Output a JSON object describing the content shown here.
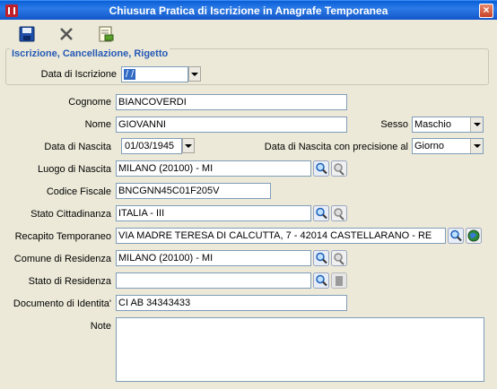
{
  "window": {
    "title": "Chiusura Pratica di Iscrizione in Anagrafe Temporanea"
  },
  "toolbar": {
    "save_icon": "save-icon",
    "cancel_icon": "close-icon",
    "print_icon": "document-edit-icon"
  },
  "group": {
    "legend": "Iscrizione, Cancellazione, Rigetto",
    "data_iscrizione_label": "Data di Iscrizione",
    "data_iscrizione_value": " / /"
  },
  "form": {
    "cognome_label": "Cognome",
    "cognome_value": "BIANCOVERDI",
    "nome_label": "Nome",
    "nome_value": "GIOVANNI",
    "sesso_label": "Sesso",
    "sesso_value": "Maschio",
    "data_nascita_label": "Data di Nascita",
    "data_nascita_value": "01/03/1945",
    "precisione_label": "Data di Nascita con precisione al",
    "precisione_value": "Giorno",
    "luogo_nascita_label": "Luogo di Nascita",
    "luogo_nascita_value": "MILANO (20100) - MI",
    "codice_fiscale_label": "Codice Fiscale",
    "codice_fiscale_value": "BNCGNN45C01F205V",
    "stato_cittadinanza_label": "Stato Cittadinanza",
    "stato_cittadinanza_value": "ITALIA - III",
    "recapito_label": "Recapito Temporaneo",
    "recapito_value": "VIA MADRE TERESA DI CALCUTTA, 7 - 42014 CASTELLARANO - RE",
    "comune_residenza_label": "Comune di Residenza",
    "comune_residenza_value": "MILANO (20100) - MI",
    "stato_residenza_label": "Stato di Residenza",
    "stato_residenza_value": "",
    "documento_label": "Documento di Identita'",
    "documento_value": "CI AB 34343433",
    "note_label": "Note",
    "note_value": ""
  }
}
